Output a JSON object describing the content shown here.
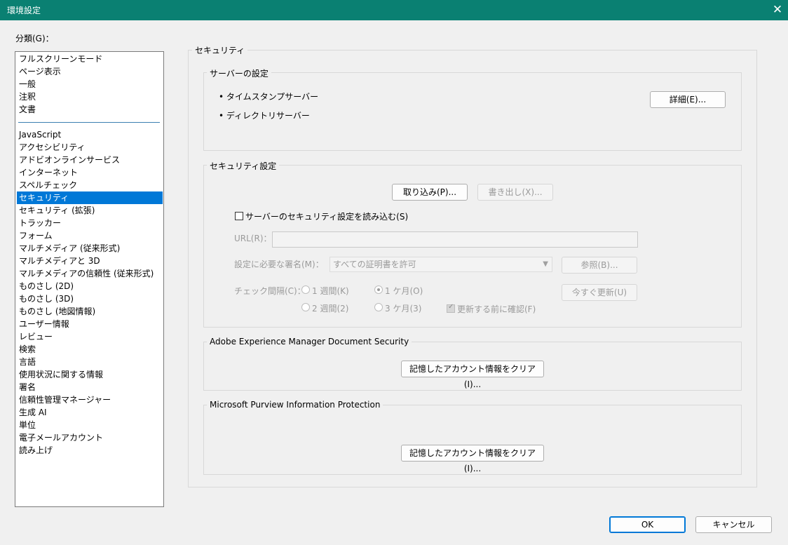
{
  "window": {
    "title": "環境設定",
    "close_glyph": "✕"
  },
  "categories": {
    "label": "分類(G)：",
    "items": [
      "フルスクリーンモード",
      "ページ表示",
      "一般",
      "注釈",
      "文書",
      "JavaScript",
      "アクセシビリティ",
      "アドビオンラインサービス",
      "インターネット",
      "スペルチェック",
      "セキュリティ",
      "セキュリティ (拡張)",
      "トラッカー",
      "フォーム",
      "マルチメディア (従来形式)",
      "マルチメディアと 3D",
      "マルチメディアの信頼性 (従来形式)",
      "ものさし (2D)",
      "ものさし (3D)",
      "ものさし (地図情報)",
      "ユーザー情報",
      "レビュー",
      "検索",
      "言語",
      "使用状況に関する情報",
      "署名",
      "信頼性管理マネージャー",
      "生成 AI",
      "単位",
      "電子メールアカウント",
      "読み上げ"
    ],
    "selected": "セキュリティ"
  },
  "security": {
    "title": "セキュリティ",
    "server": {
      "title": "サーバーの設定",
      "bullets": [
        "• タイムスタンプサーバー",
        "• ディレクトリサーバー"
      ],
      "details_button": "詳細(E)..."
    },
    "settings": {
      "title": "セキュリティ設定",
      "import_button": "取り込み(P)...",
      "export_button": "書き出し(X)...",
      "load_checkbox": "サーバーのセキュリティ設定を読み込む(S)",
      "url_label": "URL(R)：",
      "url_value": "",
      "signature_label": "設定に必要な署名(M)：",
      "signature_value": "すべての証明書を許可",
      "browse_button": "参照(B)...",
      "interval_label": "チェック間隔(C)：",
      "radios": [
        "1 週間(K)",
        "1 ケ月(O)",
        "2 週間(2)",
        "3 ケ月(3)"
      ],
      "radio_selected": "1 ケ月(O)",
      "confirm_checkbox": "更新する前に確認(F)",
      "update_now_button": "今すぐ更新(U)"
    },
    "aem": {
      "title": "Adobe Experience Manager Document Security",
      "clear_button": "記憶したアカウント情報をクリア(I)..."
    },
    "purview": {
      "title": "Microsoft Purview Information Protection",
      "clear_button": "記憶したアカウント情報をクリア(I)..."
    }
  },
  "footer": {
    "ok": "OK",
    "cancel": "キャンセル"
  },
  "colors": {
    "titlebar": "#0a8072",
    "selection": "#0078d7"
  }
}
